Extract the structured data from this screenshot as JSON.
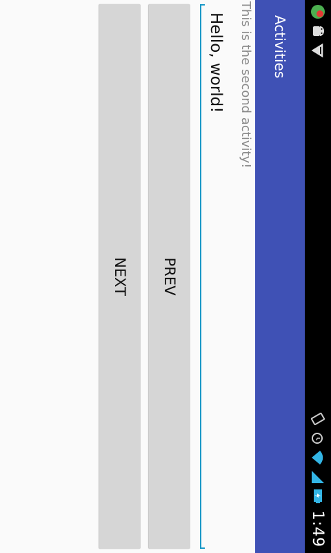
{
  "status_bar": {
    "time": "1:49",
    "left_icons": [
      "notification-app-icon",
      "android-debug-icon",
      "dropdown-notification-icon"
    ],
    "right_icons": [
      "rotate-icon",
      "alarm-icon",
      "wifi-icon",
      "cell-signal-icon",
      "battery-charging-icon"
    ]
  },
  "action_bar": {
    "title": "Activities",
    "color": "#3f51b5"
  },
  "content": {
    "subtitle": "This is the second activity!",
    "edit_text_value": "Hello, world!",
    "accent_color": "#1a98c7"
  },
  "buttons": {
    "prev_label": "PREV",
    "next_label": "NEXT"
  }
}
